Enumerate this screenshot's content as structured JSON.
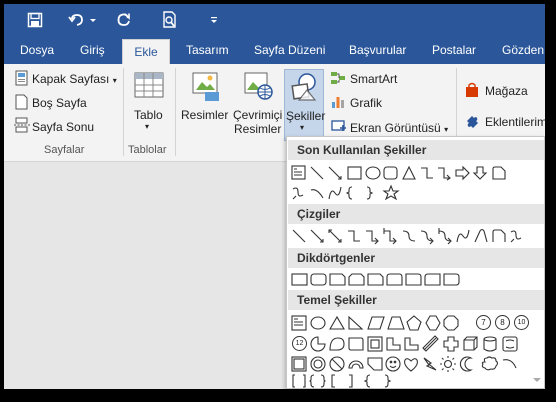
{
  "qat": {
    "save_icon": "save-icon",
    "undo_icon": "undo-icon",
    "redo_icon": "redo-icon",
    "print_preview_icon": "print-preview-icon",
    "customize_icon": "customize-qat-icon"
  },
  "tabs": [
    {
      "label": "Dosya"
    },
    {
      "label": "Giriş"
    },
    {
      "label": "Ekle"
    },
    {
      "label": "Tasarım"
    },
    {
      "label": "Sayfa Düzeni"
    },
    {
      "label": "Başvurular"
    },
    {
      "label": "Postalar"
    },
    {
      "label": "Gözden"
    }
  ],
  "ribbon": {
    "pages": {
      "cover_page": "Kapak Sayfası",
      "blank_page": "Boş Sayfa",
      "page_break": "Sayfa Sonu",
      "group_label": "Sayfalar"
    },
    "tables": {
      "table": "Tablo",
      "group_label": "Tablolar"
    },
    "illustrations": {
      "pictures": "Resimler",
      "online_pictures_line1": "Çevrimiçi",
      "online_pictures_line2": "Resimler",
      "shapes": "Şekiller",
      "smartart": "SmartArt",
      "chart": "Grafik",
      "screenshot": "Ekran Görüntüsü"
    },
    "addins": {
      "store": "Mağaza",
      "my_addins": "Eklentilerim"
    }
  },
  "gallery": {
    "recent_header": "Son Kullanılan Şekiller",
    "lines_header": "Çizgiler",
    "rectangles_header": "Dikdörtgenler",
    "basic_header": "Temel Şekiller",
    "basic_shape_labels": [
      "7",
      "8",
      "10",
      "12"
    ]
  },
  "colors": {
    "brand": "#2b579a",
    "ribbon_bg": "#f3f3f3",
    "selected_button": "#c5d5ea",
    "shape_stroke": "#333333"
  }
}
